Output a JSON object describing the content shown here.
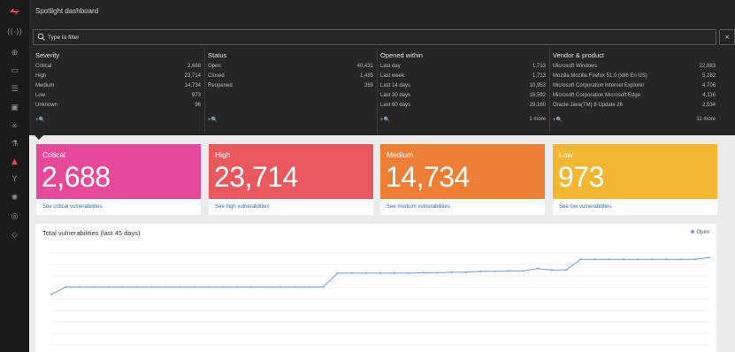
{
  "app": {
    "title": "Spotlight dashboard"
  },
  "sidebar": {
    "icons": [
      "logo-icon",
      "wifi-icon",
      "search-icon",
      "monitor-icon",
      "filter-icon",
      "image-icon",
      "link-icon",
      "flask-icon",
      "alert-icon",
      "share-icon",
      "sun-icon",
      "globe-icon",
      "shield-icon"
    ],
    "active": "alert-icon"
  },
  "filter": {
    "placeholder": "Type to filter",
    "clear": "×"
  },
  "facets": {
    "severity": {
      "title": "Severity",
      "rows": [
        {
          "label": "Critical",
          "count": "2,688"
        },
        {
          "label": "High",
          "count": "23,714"
        },
        {
          "label": "Medium",
          "count": "14,734"
        },
        {
          "label": "Low",
          "count": "973"
        },
        {
          "label": "Unknown",
          "count": "96"
        }
      ],
      "add": "+🔍",
      "more": ""
    },
    "status": {
      "title": "Status",
      "rows": [
        {
          "label": "Open",
          "count": "40,431"
        },
        {
          "label": "Closed",
          "count": "1,485"
        },
        {
          "label": "Reopened",
          "count": "269"
        }
      ],
      "add": "+🔍",
      "more": ""
    },
    "opened": {
      "title": "Opened within",
      "rows": [
        {
          "label": "Last day",
          "count": "1,713"
        },
        {
          "label": "Last week",
          "count": "1,713"
        },
        {
          "label": "Last 14 days",
          "count": "10,953"
        },
        {
          "label": "Last 30 days",
          "count": "18,592"
        },
        {
          "label": "Last 60 days",
          "count": "29,160"
        }
      ],
      "add": "+🔍",
      "more": "1 more"
    },
    "vendor": {
      "title": "Vendor & product",
      "rows": [
        {
          "label": "Microsoft Windows",
          "count": "22,883"
        },
        {
          "label": "Mozilla Mozilla Firefox 51.0 (x86 En US)",
          "count": "5,282"
        },
        {
          "label": "Microsoft Corporation Internet Explorer",
          "count": "4,706"
        },
        {
          "label": "Microsoft Corporation Microsoft Edge",
          "count": "4,116"
        },
        {
          "label": "Oracle Java(TM) 8 Update 26",
          "count": "2,534"
        }
      ],
      "add": "+🔍",
      "more": "11 more"
    }
  },
  "cards": [
    {
      "label": "Critical",
      "value": "2,688",
      "link": "See critical vulnerabilities",
      "color": "#e6489a"
    },
    {
      "label": "High",
      "value": "23,714",
      "link": "See high vulnerabilities",
      "color": "#e9585f"
    },
    {
      "label": "Medium",
      "value": "14,734",
      "link": "See medium vulnerabilities",
      "color": "#ec7f35"
    },
    {
      "label": "Low",
      "value": "973",
      "link": "See low vulnerabilities",
      "color": "#f2b732"
    }
  ],
  "chart": {
    "title": "Total vulnerabilities (last 45 days)",
    "legend": "Open",
    "series_color": "#6b9ede",
    "grid_color": "#e0e0e0"
  },
  "chart_data": {
    "type": "line",
    "title": "Total vulnerabilities (last 45 days)",
    "xlabel": "",
    "ylabel": "",
    "grid": true,
    "legend_position": "top-right",
    "series": [
      {
        "name": "Open",
        "values": [
          34500,
          35300,
          35300,
          35300,
          35300,
          35300,
          35300,
          35300,
          35300,
          35300,
          35300,
          35300,
          35300,
          35300,
          35300,
          35300,
          35300,
          35300,
          35300,
          35300,
          36800,
          36800,
          36800,
          36800,
          36800,
          36800,
          36850,
          36850,
          36900,
          36900,
          37000,
          37000,
          37050,
          37050,
          37300,
          37150,
          37150,
          38300,
          38300,
          38300,
          38300,
          38300,
          38300,
          38300,
          38300,
          38300,
          38500
        ]
      }
    ],
    "ylim": [
      29000,
      39000
    ]
  }
}
